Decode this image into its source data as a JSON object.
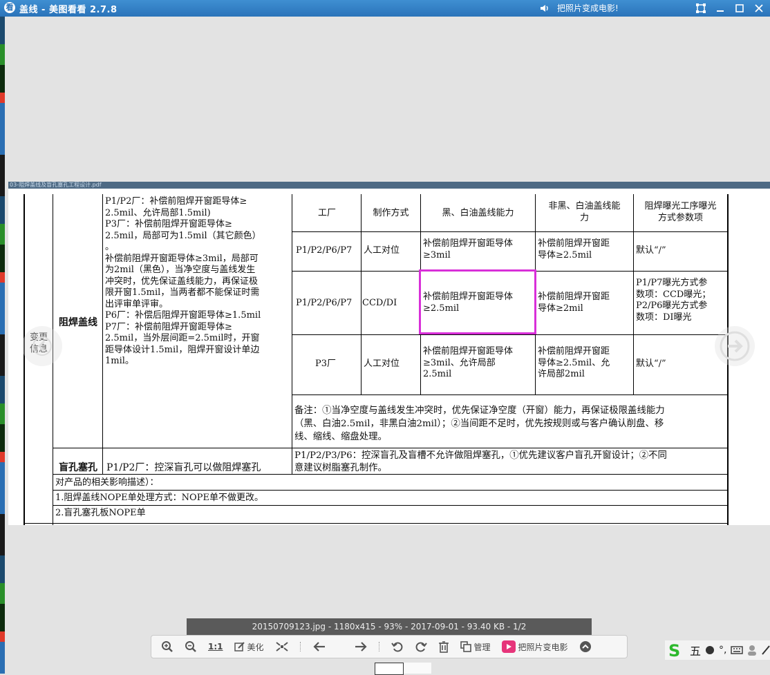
{
  "window": {
    "title": "盖线 - 美图看看 2.7.8",
    "promo_text": "把照片变成电影!",
    "app_icon_glyph": "看"
  },
  "pdf_tab": {
    "label": "03-阻焊盖线及盲孔塞孔工程设计.pdf"
  },
  "doc": {
    "left_label": "变更信息",
    "section1_label": "阻焊盖线",
    "section1_desc": [
      "P1/P2厂：补偿前阻焊开窗距导体≥",
      "2.5mil、允许局部1.5mil)",
      "P3厂：补偿前阻焊开窗距导体≥",
      "2.5mil，局部可为1.5mil（其它颜色）",
      "。",
      "补偿前阻焊开窗距导体≥3mil，局部可",
      "为2mil（黑色），当净空度与盖线发生",
      "冲突时，优先保证盖线能力，再保证极",
      "限开窗1.5mil，当两者都不能保证时需",
      "出评审单评审。",
      "P6厂：补偿后阻焊开窗距导体≥1.5mil",
      "P7厂：补偿前阻焊开窗距导体≥",
      "2.5mil，当外层间距=2.5mil时，开窗",
      "距导体设计1.5mil，阻焊开窗设计单边",
      "1mil。"
    ],
    "table": {
      "headers": [
        "工厂",
        "制作方式",
        "黑、白油盖线能力",
        [
          "非黑、白油盖线能",
          "力"
        ],
        [
          "阻焊曝光工序曝光",
          "方式参数项"
        ]
      ],
      "rows": [
        {
          "factory": "P1/P2/P6/P7",
          "method": "人工对位",
          "black_white": [
            "补偿前阻焊开窗距导体",
            "≥3mil"
          ],
          "non_black": [
            "补偿前阻焊开窗距",
            "导体≥2.5mil"
          ],
          "exposure": [
            "默认“/”"
          ]
        },
        {
          "factory": "P1/P2/P6/P7",
          "method": "CCD/DI",
          "black_white": [
            "补偿前阻焊开窗距导体",
            "≥2.5mil"
          ],
          "non_black": [
            "补偿前阻焊开窗距",
            "导体≥2mil"
          ],
          "exposure": [
            "P1/P7曝光方式参",
            "数项：CCD曝光；",
            "P2/P6曝光方式参",
            "数项：DI曝光"
          ]
        },
        {
          "factory": "P3厂",
          "method": "人工对位",
          "black_white": [
            "补偿前阻焊开窗距导体",
            "≥3mil、允许局部",
            "2.5mil"
          ],
          "non_black": [
            "补偿前阻焊开窗距",
            "导体≥2.5mil、允",
            "许局部2mil"
          ],
          "exposure": [
            "默认“/”"
          ]
        }
      ],
      "note": [
        "备注：①当净空度与盖线发生冲突时，优先保证净空度（开窗）能力，再保证极限盖线能力",
        "（黑、白油2.5mil，非黑白油2mil）；②当间距不足时，优先按规则或与客户确认削盘、移",
        "线、缩线、缩盘处理。"
      ]
    },
    "section2_label": "盲孔塞孔",
    "section2_desc": "P1/P2厂：控深盲孔可以做阻焊塞孔",
    "section2_detail": [
      "P1/P2/P3/P6：控深盲孔及盲槽不允许做阻焊塞孔，①优先建议客户盲孔开窗设计；②不同",
      "意建议树脂塞孔制作。"
    ],
    "impact_title": "对产品的相关影响描述）：",
    "impact_line1": "1.阻焊盖线NOPE单处理方式：NOPE单不做更改。",
    "impact_line2": "2.盲孔塞孔板NOPE单"
  },
  "info_bar": {
    "text": "20150709123.jpg - 1180x415 - 93% - 2017-09-01 - 93.40 KB - 1/2"
  },
  "toolbar": {
    "actual_size": "1:1",
    "beautify": "美化",
    "manage": "管理",
    "movie": "把照片变电影"
  },
  "ime": {
    "mode": "五",
    "punct": "°,"
  },
  "colors": {
    "accent": "#2a73b9",
    "highlight": "#d82fd8"
  }
}
